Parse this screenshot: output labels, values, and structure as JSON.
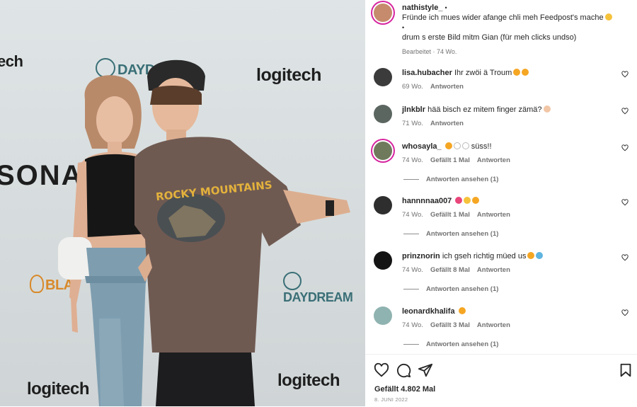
{
  "post": {
    "author": "nathistyle_",
    "dot": "•",
    "caption_line1": "Fründe ich mues wider afange chli meh Feedpost's mache",
    "bullet": "•",
    "caption_line2": "drum s erste Bild mitm Gian (für meh clicks undso)",
    "edited": "Bearbeitet · 74 Wo."
  },
  "photo": {
    "wall_logos": [
      "ech",
      "DAYD",
      "logitech",
      "SONA",
      "DAYDREAM",
      "BLA",
      "logitech",
      "logitech"
    ],
    "shirt_text": "ROCKY MOUNTAINS"
  },
  "comments": [
    {
      "user": "lisa.hubacher",
      "text": "Ihr zwöi ä Troum",
      "time": "69 Wo.",
      "likes": "",
      "reply": "Antworten",
      "view_replies": ""
    },
    {
      "user": "jlnkblr",
      "text": "hää bisch ez mitem finger zämä?",
      "time": "71 Wo.",
      "likes": "",
      "reply": "Antworten",
      "view_replies": ""
    },
    {
      "user": "whosayla_",
      "text": "süss!!",
      "time": "74 Wo.",
      "likes": "Gefällt 1 Mal",
      "reply": "Antworten",
      "view_replies": "Antworten ansehen (1)"
    },
    {
      "user": "hannnnaa007",
      "text": "",
      "time": "74 Wo.",
      "likes": "Gefällt 1 Mal",
      "reply": "Antworten",
      "view_replies": "Antworten ansehen (1)"
    },
    {
      "user": "prinznorin",
      "text": "ich gseh richtig müed us",
      "time": "74 Wo.",
      "likes": "Gefällt 8 Mal",
      "reply": "Antworten",
      "view_replies": "Antworten ansehen (1)"
    },
    {
      "user": "leonardkhalifa",
      "text": "",
      "time": "74 Wo.",
      "likes": "Gefällt 3 Mal",
      "reply": "Antworten",
      "view_replies": "Antworten ansehen (1)"
    }
  ],
  "footer": {
    "likes": "Gefällt 4.802 Mal",
    "date": "8. JUNI 2022"
  },
  "icons": [
    "heart-icon",
    "comment-icon",
    "share-icon",
    "bookmark-icon"
  ],
  "colors": {
    "story_ring": "#d6249f",
    "meta": "#737373",
    "text": "#262626"
  }
}
